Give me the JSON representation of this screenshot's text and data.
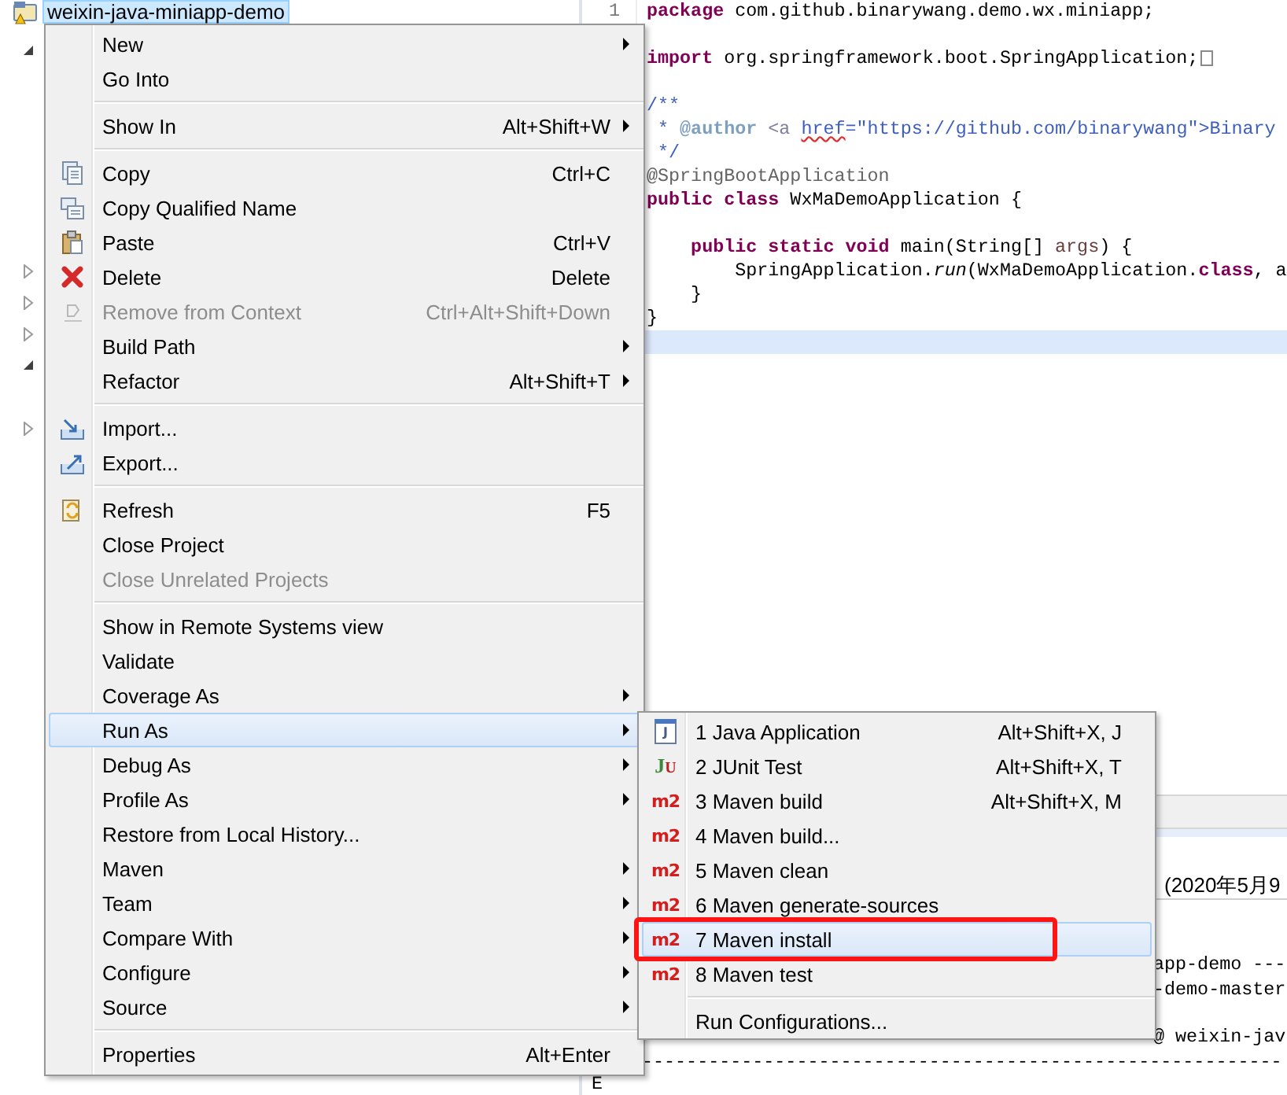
{
  "project_explorer": {
    "rows": [
      {
        "kind": "project",
        "label": "weixin-java-miniapp-demo",
        "selected": true
      },
      {
        "kind": "expanded"
      },
      {
        "kind": "leaf"
      },
      {
        "kind": "leaf"
      },
      {
        "kind": "leaf"
      },
      {
        "kind": "leaf"
      },
      {
        "kind": "leaf"
      },
      {
        "kind": "leaf"
      },
      {
        "kind": "collapsed"
      },
      {
        "kind": "collapsed"
      },
      {
        "kind": "collapsed"
      },
      {
        "kind": "expanded"
      },
      {
        "kind": "leaf"
      },
      {
        "kind": "collapsed"
      }
    ]
  },
  "editor": {
    "line_number": "1",
    "lines": [
      {
        "kind": "code",
        "current": false,
        "tokens": [
          {
            "kind": "keyword",
            "text": "package"
          },
          {
            "kind": "plain",
            "text": " com.github.binarywang.demo.wx.miniapp;"
          }
        ]
      },
      {
        "kind": "blank",
        "current": false
      },
      {
        "kind": "folded",
        "current": false,
        "tokens": [
          {
            "kind": "keyword",
            "text": "import"
          },
          {
            "kind": "plain",
            "text": " org.springframework.boot.SpringApplication;"
          }
        ]
      },
      {
        "kind": "blank",
        "current": false
      },
      {
        "kind": "code",
        "current": false,
        "tokens": [
          {
            "kind": "comment",
            "text": "/**"
          }
        ]
      },
      {
        "kind": "code",
        "current": false,
        "tokens": [
          {
            "kind": "comment",
            "text": " * "
          },
          {
            "kind": "doctag",
            "text": "@author"
          },
          {
            "kind": "htmltag",
            "text": " <a "
          },
          {
            "kind": "misspelled",
            "text": "href"
          },
          {
            "kind": "comment",
            "text": "=\"https://github.com/binarywang\">Binary"
          }
        ]
      },
      {
        "kind": "code",
        "current": false,
        "tokens": [
          {
            "kind": "comment",
            "text": " */"
          }
        ]
      },
      {
        "kind": "code",
        "current": false,
        "tokens": [
          {
            "kind": "annotation",
            "text": "@SpringBootApplication"
          }
        ]
      },
      {
        "kind": "code",
        "current": false,
        "tokens": [
          {
            "kind": "keyword",
            "text": "public class"
          },
          {
            "kind": "plain",
            "text": " WxMaDemoApplication {"
          }
        ]
      },
      {
        "kind": "blank",
        "current": false
      },
      {
        "kind": "code",
        "current": false,
        "tokens": [
          {
            "kind": "keyword",
            "text": "    public static void"
          },
          {
            "kind": "plain",
            "text": " main(String[] "
          },
          {
            "kind": "param",
            "text": "args"
          },
          {
            "kind": "plain",
            "text": ") {"
          }
        ]
      },
      {
        "kind": "code",
        "current": false,
        "tokens": [
          {
            "kind": "plain",
            "text": "        SpringApplication."
          },
          {
            "kind": "italic",
            "text": "run"
          },
          {
            "kind": "plain",
            "text": "(WxMaDemoApplication."
          },
          {
            "kind": "keyword",
            "text": "class"
          },
          {
            "kind": "plain",
            "text": ", a"
          }
        ]
      },
      {
        "kind": "code",
        "current": false,
        "tokens": [
          {
            "kind": "plain",
            "text": "    }"
          }
        ]
      },
      {
        "kind": "code",
        "current": false,
        "tokens": [
          {
            "kind": "plain",
            "text": "}"
          }
        ]
      },
      {
        "kind": "blank",
        "current": true
      }
    ]
  },
  "console": {
    "header": "(2020年5月9",
    "lines": [
      {
        "kind": "blank"
      },
      {
        "kind": "tail",
        "text": "app-demo ---"
      },
      {
        "kind": "tail",
        "text": "-demo-master"
      },
      {
        "kind": "gap"
      },
      {
        "kind": "tail",
        "text": "@ weixin-jav"
      },
      {
        "kind": "rule",
        "text": "----------------------------------------------------------"
      },
      {
        "kind": "text",
        "text": "E"
      }
    ]
  },
  "context_menu": {
    "items": [
      {
        "kind": "plain",
        "label": "New",
        "submenu": true,
        "disabled": false,
        "selected": false
      },
      {
        "kind": "plain",
        "label": "Go Into",
        "submenu": false,
        "disabled": false,
        "selected": false
      },
      {
        "kind": "separator"
      },
      {
        "kind": "plain",
        "label": "Show In",
        "shortcut": "Alt+Shift+W",
        "submenu": true,
        "disabled": false,
        "selected": false
      },
      {
        "kind": "separator"
      },
      {
        "kind": "copy",
        "label": "Copy",
        "shortcut": "Ctrl+C",
        "submenu": false,
        "disabled": false,
        "selected": false
      },
      {
        "kind": "copy-name",
        "label": "Copy Qualified Name",
        "submenu": false,
        "disabled": false,
        "selected": false
      },
      {
        "kind": "paste",
        "label": "Paste",
        "shortcut": "Ctrl+V",
        "submenu": false,
        "disabled": false,
        "selected": false
      },
      {
        "kind": "delete",
        "label": "Delete",
        "shortcut": "Delete",
        "submenu": false,
        "disabled": false,
        "selected": false
      },
      {
        "kind": "remove",
        "label": "Remove from Context",
        "shortcut": "Ctrl+Alt+Shift+Down",
        "submenu": false,
        "disabled": true,
        "selected": false
      },
      {
        "kind": "plain",
        "label": "Build Path",
        "submenu": true,
        "disabled": false,
        "selected": false
      },
      {
        "kind": "plain",
        "label": "Refactor",
        "shortcut": "Alt+Shift+T",
        "submenu": true,
        "disabled": false,
        "selected": false
      },
      {
        "kind": "separator"
      },
      {
        "kind": "import",
        "label": "Import...",
        "submenu": false,
        "disabled": false,
        "selected": false
      },
      {
        "kind": "export",
        "label": "Export...",
        "submenu": false,
        "disabled": false,
        "selected": false
      },
      {
        "kind": "separator"
      },
      {
        "kind": "refresh",
        "label": "Refresh",
        "shortcut": "F5",
        "submenu": false,
        "disabled": false,
        "selected": false
      },
      {
        "kind": "plain",
        "label": "Close Project",
        "submenu": false,
        "disabled": false,
        "selected": false
      },
      {
        "kind": "plain",
        "label": "Close Unrelated Projects",
        "submenu": false,
        "disabled": true,
        "selected": false
      },
      {
        "kind": "separator"
      },
      {
        "kind": "plain",
        "label": "Show in Remote Systems view",
        "submenu": false,
        "disabled": false,
        "selected": false
      },
      {
        "kind": "plain",
        "label": "Validate",
        "submenu": false,
        "disabled": false,
        "selected": false
      },
      {
        "kind": "plain",
        "label": "Coverage As",
        "submenu": true,
        "disabled": false,
        "selected": false
      },
      {
        "kind": "plain",
        "label": "Run As",
        "submenu": true,
        "disabled": false,
        "selected": true
      },
      {
        "kind": "plain",
        "label": "Debug As",
        "submenu": true,
        "disabled": false,
        "selected": false
      },
      {
        "kind": "plain",
        "label": "Profile As",
        "submenu": true,
        "disabled": false,
        "selected": false
      },
      {
        "kind": "plain",
        "label": "Restore from Local History...",
        "submenu": false,
        "disabled": false,
        "selected": false
      },
      {
        "kind": "plain",
        "label": "Maven",
        "submenu": true,
        "disabled": false,
        "selected": false
      },
      {
        "kind": "plain",
        "label": "Team",
        "submenu": true,
        "disabled": false,
        "selected": false
      },
      {
        "kind": "plain",
        "label": "Compare With",
        "submenu": true,
        "disabled": false,
        "selected": false
      },
      {
        "kind": "plain",
        "label": "Configure",
        "submenu": true,
        "disabled": false,
        "selected": false
      },
      {
        "kind": "plain",
        "label": "Source",
        "submenu": true,
        "disabled": false,
        "selected": false
      },
      {
        "kind": "separator"
      },
      {
        "kind": "plain",
        "label": "Properties",
        "shortcut": "Alt+Enter",
        "submenu": false,
        "disabled": false,
        "selected": false
      }
    ]
  },
  "run_as_submenu": {
    "items": [
      {
        "kind": "java",
        "label": "1 Java Application",
        "shortcut": "Alt+Shift+X, J",
        "icon_text": "J",
        "selected": false,
        "annotated": false
      },
      {
        "kind": "junit",
        "label": "2 JUnit Test",
        "shortcut": "Alt+Shift+X, T",
        "icon_text": "JU",
        "selected": false,
        "annotated": false
      },
      {
        "kind": "maven",
        "label": "3 Maven build",
        "shortcut": "Alt+Shift+X, M",
        "icon_text": "m2",
        "selected": false,
        "annotated": false
      },
      {
        "kind": "maven",
        "label": "4 Maven build...",
        "icon_text": "m2",
        "selected": false,
        "annotated": false
      },
      {
        "kind": "maven",
        "label": "5 Maven clean",
        "icon_text": "m2",
        "selected": false,
        "annotated": false
      },
      {
        "kind": "maven",
        "label": "6 Maven generate-sources",
        "icon_text": "m2",
        "selected": false,
        "annotated": false
      },
      {
        "kind": "maven",
        "label": "7 Maven install",
        "icon_text": "m2",
        "selected": true,
        "annotated": true
      },
      {
        "kind": "maven",
        "label": "8 Maven test",
        "icon_text": "m2",
        "selected": false,
        "annotated": false
      },
      {
        "kind": "separator"
      },
      {
        "kind": "plain",
        "label": "Run Configurations...",
        "selected": false,
        "annotated": false
      }
    ]
  }
}
